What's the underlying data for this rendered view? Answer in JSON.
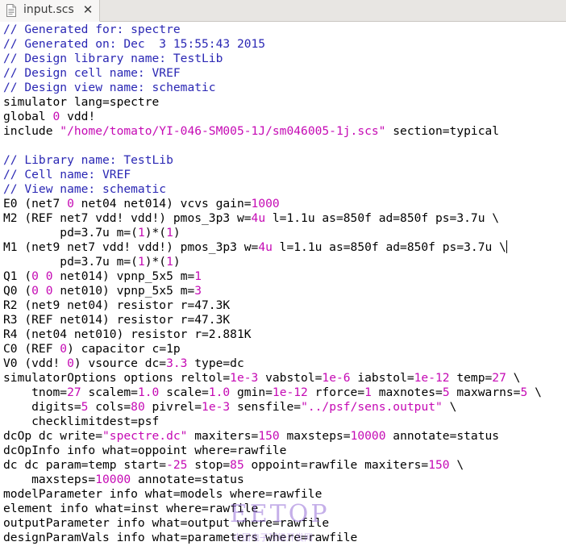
{
  "tab": {
    "filename": "input.scs",
    "close_glyph": "✕",
    "icon": "text-file-icon"
  },
  "colors": {
    "comment": "#2a27b4",
    "number": "#c50ab4",
    "string": "#c50ab4",
    "text": "#000000"
  },
  "editor": {
    "lines": [
      [
        [
          "c",
          "// Generated for: spectre"
        ]
      ],
      [
        [
          "c",
          "// Generated on: Dec  3 15:55:43 2015"
        ]
      ],
      [
        [
          "c",
          "// Design library name: TestLib"
        ]
      ],
      [
        [
          "c",
          "// Design cell name: VREF"
        ]
      ],
      [
        [
          "c",
          "// Design view name: schematic"
        ]
      ],
      [
        [
          "t",
          "simulator lang=spectre"
        ]
      ],
      [
        [
          "t",
          "global "
        ],
        [
          "n",
          "0"
        ],
        [
          "t",
          " vdd!"
        ]
      ],
      [
        [
          "t",
          "include "
        ],
        [
          "s",
          "\"/home/tomato/YI-046-SM005-1J/sm046005-1j.scs\""
        ],
        [
          "t",
          " section=typical"
        ]
      ],
      [],
      [
        [
          "c",
          "// Library name: TestLib"
        ]
      ],
      [
        [
          "c",
          "// Cell name: VREF"
        ]
      ],
      [
        [
          "c",
          "// View name: schematic"
        ]
      ],
      [
        [
          "t",
          "E0 (net7 "
        ],
        [
          "n",
          "0"
        ],
        [
          "t",
          " net04 net014) vcvs gain="
        ],
        [
          "n",
          "1000"
        ]
      ],
      [
        [
          "t",
          "M2 (REF net7 vdd! vdd!) pmos_3p3 w="
        ],
        [
          "n",
          "4u"
        ],
        [
          "t",
          " l=1.1u as=850f ad=850f ps=3.7u \\"
        ]
      ],
      [
        [
          "t",
          "        pd=3.7u m=("
        ],
        [
          "n",
          "1"
        ],
        [
          "t",
          ")*("
        ],
        [
          "n",
          "1"
        ],
        [
          "t",
          ")"
        ]
      ],
      [
        [
          "t",
          "M1 (net9 net7 vdd! vdd!) pmos_3p3 w="
        ],
        [
          "n",
          "4u"
        ],
        [
          "t",
          " l=1.1u as=850f ad=850f ps=3.7u \\"
        ],
        [
          "caret",
          ""
        ]
      ],
      [
        [
          "t",
          "        pd=3.7u m=("
        ],
        [
          "n",
          "1"
        ],
        [
          "t",
          ")*("
        ],
        [
          "n",
          "1"
        ],
        [
          "t",
          ")"
        ]
      ],
      [
        [
          "t",
          "Q1 ("
        ],
        [
          "n",
          "0"
        ],
        [
          "t",
          " "
        ],
        [
          "n",
          "0"
        ],
        [
          "t",
          " net014) vpnp_5x5 m="
        ],
        [
          "n",
          "1"
        ]
      ],
      [
        [
          "t",
          "Q0 ("
        ],
        [
          "n",
          "0"
        ],
        [
          "t",
          " "
        ],
        [
          "n",
          "0"
        ],
        [
          "t",
          " net010) vpnp_5x5 m="
        ],
        [
          "n",
          "3"
        ]
      ],
      [
        [
          "t",
          "R2 (net9 net04) resistor r=47.3K"
        ]
      ],
      [
        [
          "t",
          "R3 (REF net014) resistor r=47.3K"
        ]
      ],
      [
        [
          "t",
          "R4 (net04 net010) resistor r=2.881K"
        ]
      ],
      [
        [
          "t",
          "C0 (REF "
        ],
        [
          "n",
          "0"
        ],
        [
          "t",
          ") capacitor c=1p"
        ]
      ],
      [
        [
          "t",
          "V0 (vdd! "
        ],
        [
          "n",
          "0"
        ],
        [
          "t",
          ") vsource dc="
        ],
        [
          "n",
          "3.3"
        ],
        [
          "t",
          " type=dc"
        ]
      ],
      [
        [
          "t",
          "simulatorOptions options reltol="
        ],
        [
          "n",
          "1e-3"
        ],
        [
          "t",
          " vabstol="
        ],
        [
          "n",
          "1e-6"
        ],
        [
          "t",
          " iabstol="
        ],
        [
          "n",
          "1e-12"
        ],
        [
          "t",
          " temp="
        ],
        [
          "n",
          "27"
        ],
        [
          "t",
          " \\"
        ]
      ],
      [
        [
          "t",
          "    tnom="
        ],
        [
          "n",
          "27"
        ],
        [
          "t",
          " scalem="
        ],
        [
          "n",
          "1.0"
        ],
        [
          "t",
          " scale="
        ],
        [
          "n",
          "1.0"
        ],
        [
          "t",
          " gmin="
        ],
        [
          "n",
          "1e-12"
        ],
        [
          "t",
          " rforce="
        ],
        [
          "n",
          "1"
        ],
        [
          "t",
          " maxnotes="
        ],
        [
          "n",
          "5"
        ],
        [
          "t",
          " maxwarns="
        ],
        [
          "n",
          "5"
        ],
        [
          "t",
          " \\"
        ]
      ],
      [
        [
          "t",
          "    digits="
        ],
        [
          "n",
          "5"
        ],
        [
          "t",
          " cols="
        ],
        [
          "n",
          "80"
        ],
        [
          "t",
          " pivrel="
        ],
        [
          "n",
          "1e-3"
        ],
        [
          "t",
          " sensfile="
        ],
        [
          "s",
          "\"../psf/sens.output\""
        ],
        [
          "t",
          " \\"
        ]
      ],
      [
        [
          "t",
          "    checklimitdest=psf"
        ]
      ],
      [
        [
          "t",
          "dcOp dc write="
        ],
        [
          "s",
          "\"spectre.dc\""
        ],
        [
          "t",
          " maxiters="
        ],
        [
          "n",
          "150"
        ],
        [
          "t",
          " maxsteps="
        ],
        [
          "n",
          "10000"
        ],
        [
          "t",
          " annotate=status"
        ]
      ],
      [
        [
          "t",
          "dcOpInfo info what=oppoint where=rawfile"
        ]
      ],
      [
        [
          "t",
          "dc dc param=temp start="
        ],
        [
          "n",
          "-25"
        ],
        [
          "t",
          " stop="
        ],
        [
          "n",
          "85"
        ],
        [
          "t",
          " oppoint=rawfile maxiters="
        ],
        [
          "n",
          "150"
        ],
        [
          "t",
          " \\"
        ]
      ],
      [
        [
          "t",
          "    maxsteps="
        ],
        [
          "n",
          "10000"
        ],
        [
          "t",
          " annotate=status"
        ]
      ],
      [
        [
          "t",
          "modelParameter info what=models where=rawfile"
        ]
      ],
      [
        [
          "t",
          "element info what=inst where=rawfile"
        ]
      ],
      [
        [
          "t",
          "outputParameter info what=output where=rawfile"
        ]
      ],
      [
        [
          "t",
          "designParamVals info what=parameters where=rawfile"
        ]
      ]
    ]
  },
  "watermark": {
    "main": "EETOP",
    "sub": "中国电子顶级开发网"
  }
}
